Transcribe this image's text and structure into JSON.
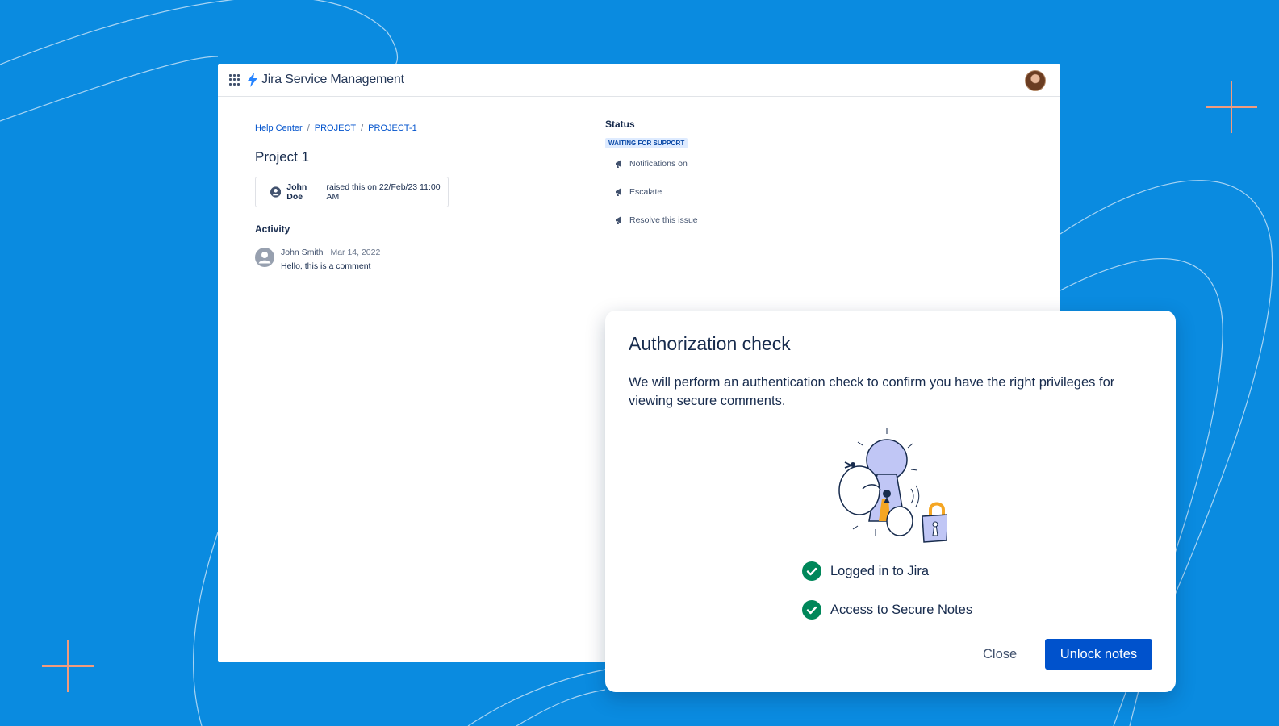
{
  "header": {
    "product_name": "Jira Service Management"
  },
  "breadcrumb": {
    "items": [
      "Help Center",
      "PROJECT",
      "PROJECT-1"
    ]
  },
  "request": {
    "title": "Project 1",
    "raised_by": "John Doe",
    "raised_text": "raised this on 22/Feb/23 11:00 AM"
  },
  "activity": {
    "heading": "Activity",
    "comments": [
      {
        "author": "John Smith",
        "date": "Mar 14, 2022",
        "text": "Hello, this is a comment"
      }
    ]
  },
  "status": {
    "heading": "Status",
    "badge": "WAITING FOR SUPPORT",
    "actions": [
      "Notifications on",
      "Escalate",
      "Resolve this issue"
    ]
  },
  "modal": {
    "title": "Authorization check",
    "description": "We will perform an authentication check to confirm you have the right privileges for viewing secure comments.",
    "checks": [
      "Logged in to Jira",
      "Access to Secure Notes"
    ],
    "close_label": "Close",
    "unlock_label": "Unlock notes"
  },
  "colors": {
    "background": "#0a8be0",
    "primary": "#0052cc",
    "success": "#00875a",
    "accent_plus": "#f29b7d"
  }
}
